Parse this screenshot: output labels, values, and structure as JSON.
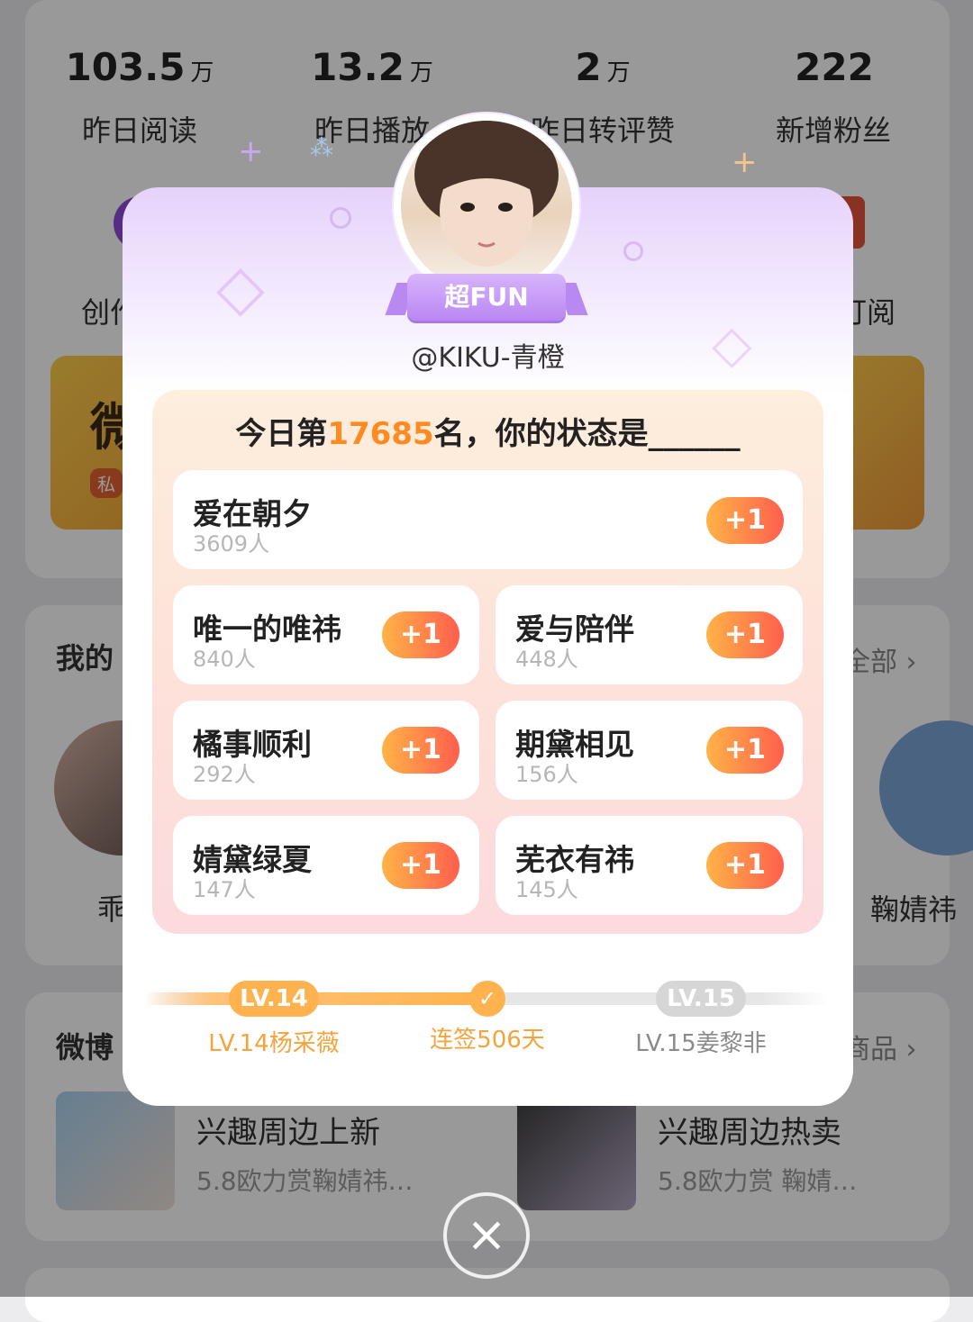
{
  "stats": [
    {
      "value": "103.5",
      "unit": "万",
      "label": "昨日阅读"
    },
    {
      "value": "13.2",
      "unit": "万",
      "label": "昨日播放"
    },
    {
      "value": "2",
      "unit": "万",
      "label": "昨日转评赞"
    },
    {
      "value": "222",
      "unit": "",
      "label": "新增粉丝"
    }
  ],
  "background": {
    "partial_left_label": "创作",
    "partial_right_label": "订阅",
    "banner_text": "微",
    "banner_tag": "私",
    "section_mine": "我的",
    "section_mine_more": "全部",
    "person_left_name": "乖",
    "person_right_name": "鞠婧祎",
    "section_weibo": "微博",
    "section_weibo_more": "商品",
    "products": [
      {
        "title": "兴趣周边上新",
        "subtitle": "5.8欧力赏鞠婧祎…"
      },
      {
        "title": "兴趣周边热卖",
        "subtitle": "5.8欧力赏 鞠婧…"
      }
    ]
  },
  "modal": {
    "badge": "超FUN",
    "username": "@KIKU-青橙",
    "rank_prefix": "今日第",
    "rank_number": "17685",
    "rank_suffix": "名，你的状态是______",
    "options": [
      {
        "name": "爱在朝夕",
        "count": "3609人"
      },
      {
        "name": "唯一的唯祎",
        "count": "840人"
      },
      {
        "name": "爱与陪伴",
        "count": "448人"
      },
      {
        "name": "橘事顺利",
        "count": "292人"
      },
      {
        "name": "期黛相见",
        "count": "156人"
      },
      {
        "name": "婧黛绿夏",
        "count": "147人"
      },
      {
        "name": "芜衣有祎",
        "count": "145人"
      }
    ],
    "plus_label": "+1",
    "level": {
      "current_badge": "LV.14",
      "current_caption": "LV.14杨采薇",
      "streak_caption": "连签506天",
      "next_badge": "LV.15",
      "next_caption": "LV.15姜黎非"
    },
    "close_symbol": "×"
  },
  "colors": {
    "accent_orange": "#ff8a1f",
    "badge_purple": "#b987f3",
    "plus_start": "#ffb347",
    "plus_end": "#ff5f4e"
  }
}
